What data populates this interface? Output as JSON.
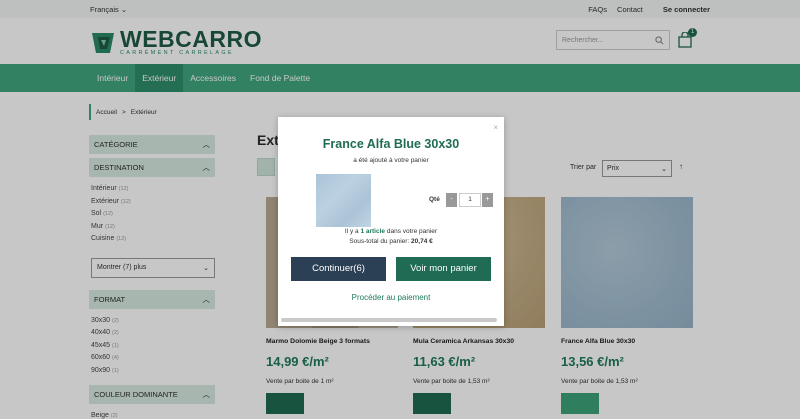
{
  "topbar": {
    "language": "Français",
    "faqs": "FAQs",
    "contact": "Contact",
    "login": "Se connecter"
  },
  "logo": {
    "title": "WEBCARRO",
    "subtitle": "CARRÉMENT CARRELAGE"
  },
  "search": {
    "placeholder": "Rechercher..."
  },
  "cart": {
    "count": "1"
  },
  "nav": {
    "items": [
      "Intérieur",
      "Extérieur",
      "Accessoires",
      "Fond de Palette"
    ]
  },
  "breadcrumb": {
    "home": "Accueil",
    "separator": ">",
    "current": "Extérieur"
  },
  "sidebar": {
    "category": "CATÉGORIE",
    "destination": "DESTINATION",
    "destination_items": [
      {
        "label": "Intérieur",
        "count": "(12)"
      },
      {
        "label": "Extérieur",
        "count": "(12)"
      },
      {
        "label": "Sol",
        "count": "(12)"
      },
      {
        "label": "Mur",
        "count": "(12)"
      },
      {
        "label": "Cuisine",
        "count": "(12)"
      }
    ],
    "more": "Montrer (7) plus",
    "format": "FORMAT",
    "format_items": [
      {
        "label": "30x30",
        "count": "(2)"
      },
      {
        "label": "40x40",
        "count": "(2)"
      },
      {
        "label": "45x45",
        "count": "(1)"
      },
      {
        "label": "60x60",
        "count": "(4)"
      },
      {
        "label": "90x90",
        "count": "(1)"
      }
    ],
    "couleur": "COULEUR DOMINANTE",
    "couleur_items": [
      {
        "label": "Beige",
        "count": "(2)"
      }
    ]
  },
  "main": {
    "title": "Exté",
    "sort_label": "Trier par",
    "sort_value": "Prix",
    "sort_arrow": "↑"
  },
  "products": [
    {
      "name": "Marmo Dolomie Beige 3 formats",
      "price": "14,99 €/m²",
      "unit": "Vente par boite de 1 m²"
    },
    {
      "name": "Mula Ceramica Arkansas 30x30",
      "price": "11,63 €/m²",
      "unit": "Vente par boite de 1,53 m²"
    },
    {
      "name": "France Alfa Blue 30x30",
      "price": "13,56 €/m²",
      "unit": "Vente par boite de 1,53 m²"
    }
  ],
  "modal": {
    "close": "×",
    "title": "France Alfa Blue 30x30",
    "subtitle": "a été ajouté à votre panier",
    "qty_label": "Qté",
    "qty_minus": "-",
    "qty_value": "1",
    "qty_plus": "+",
    "cart_line_prefix": "Il y a",
    "cart_line_count": "1 article",
    "cart_line_suffix": "dans votre panier",
    "subtotal_label": "Sous-total du panier:",
    "subtotal_value": "20,74 €",
    "continue_label": "Continuer(6)",
    "view_cart_label": "Voir mon panier",
    "checkout_label": "Procéder au paiement"
  },
  "colors": {
    "brand": "#1f6b53",
    "nav": "#41a67f",
    "continue": "#2b3f55"
  }
}
